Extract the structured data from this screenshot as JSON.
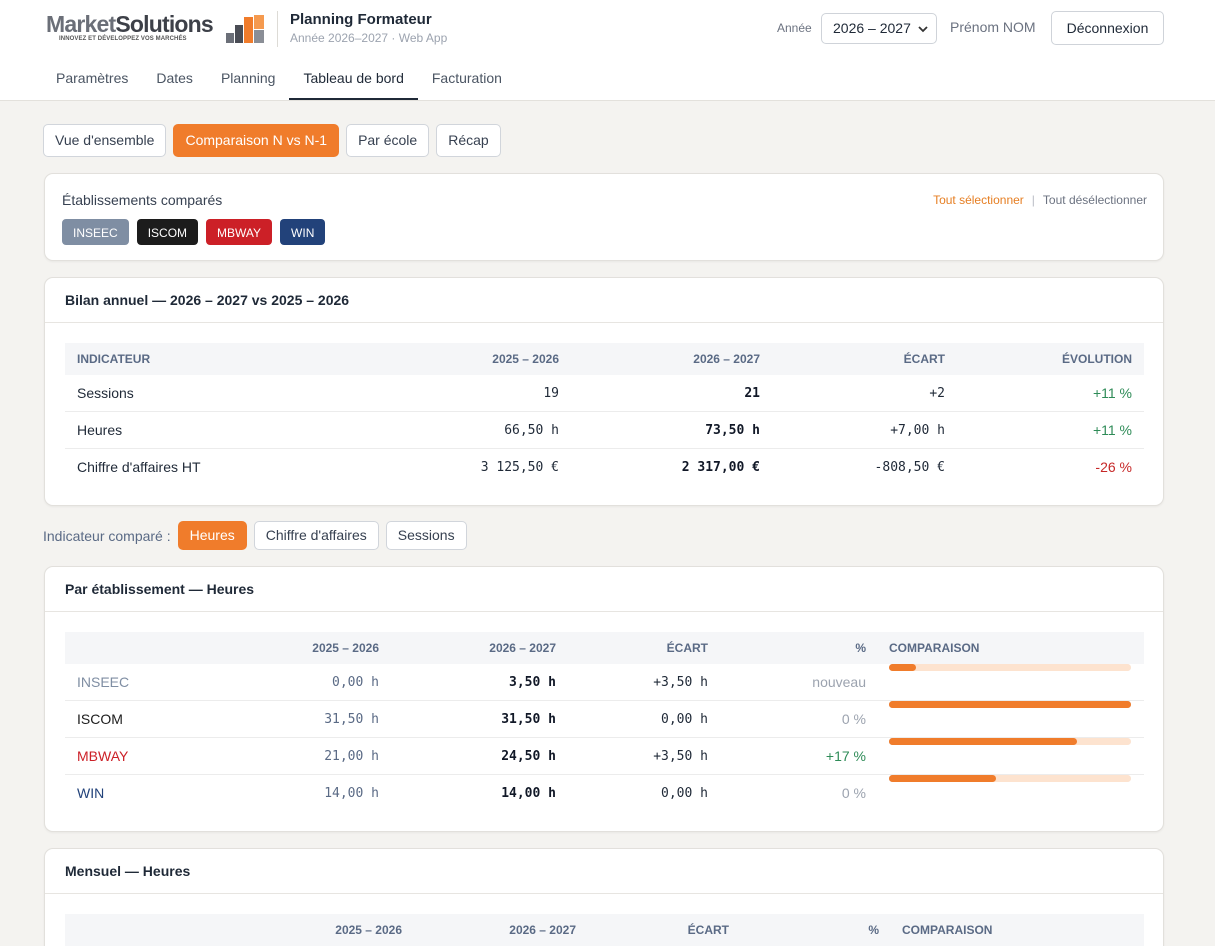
{
  "header": {
    "logo": {
      "word_regular": "Market",
      "word_bold": "Solutions",
      "tagline": "INNOVEZ ET DÉVELOPPEZ VOS MARCHÉS"
    },
    "app_title": "Planning Formateur",
    "app_subtitle": "Année 2026–2027 · Web App",
    "year_label": "Année",
    "year_value": "2026 – 2027",
    "user_name": "Prénom NOM",
    "logout_label": "Déconnexion"
  },
  "nav": [
    {
      "label": "Paramètres",
      "active": false
    },
    {
      "label": "Dates",
      "active": false
    },
    {
      "label": "Planning",
      "active": false
    },
    {
      "label": "Tableau de bord",
      "active": true
    },
    {
      "label": "Facturation",
      "active": false
    }
  ],
  "subtabs": [
    {
      "label": "Vue d'ensemble",
      "active": false
    },
    {
      "label": "Comparaison N vs N-1",
      "active": true
    },
    {
      "label": "Par école",
      "active": false
    },
    {
      "label": "Récap",
      "active": false
    }
  ],
  "establishments": {
    "title": "Établissements comparés",
    "select_all": "Tout sélectionner",
    "separator": "|",
    "deselect_all": "Tout désélectionner",
    "chips": [
      {
        "label": "INSEEC",
        "color": "#7f8ea3"
      },
      {
        "label": "ISCOM",
        "color": "#1c1c1c"
      },
      {
        "label": "MBWAY",
        "color": "#cc2027"
      },
      {
        "label": "WIN",
        "color": "#22427a"
      }
    ]
  },
  "bilan": {
    "title": "Bilan annuel — 2026 – 2027 vs 2025 – 2026",
    "headers": {
      "indicator": "INDICATEUR",
      "prev": "2025 – 2026",
      "curr": "2026 – 2027",
      "diff": "ÉCART",
      "evol": "ÉVOLUTION"
    },
    "rows": [
      {
        "indicator": "Sessions",
        "prev": "19",
        "curr": "21",
        "diff": "+2",
        "evol": "+11 %",
        "trend": "up"
      },
      {
        "indicator": "Heures",
        "prev": "66,50 h",
        "curr": "73,50 h",
        "diff": "+7,00 h",
        "evol": "+11 %",
        "trend": "up"
      },
      {
        "indicator": "Chiffre d'affaires HT",
        "prev": "3 125,50 €",
        "curr": "2 317,00 €",
        "diff": "-808,50 €",
        "evol": "-26 %",
        "trend": "down"
      }
    ]
  },
  "indicator_toggle": {
    "label": "Indicateur comparé :",
    "options": [
      {
        "label": "Heures",
        "active": true
      },
      {
        "label": "Chiffre d'affaires",
        "active": false
      },
      {
        "label": "Sessions",
        "active": false
      }
    ]
  },
  "par_etablissement": {
    "title": "Par établissement — Heures",
    "headers": {
      "name": "",
      "prev": "2025 – 2026",
      "curr": "2026 – 2027",
      "diff": "ÉCART",
      "pct": "%",
      "comparison": "COMPARAISON"
    },
    "rows": [
      {
        "name": "INSEEC",
        "name_color": "#7f8ea3",
        "prev": "0,00 h",
        "curr": "3,50 h",
        "diff": "+3,50 h",
        "pct": "nouveau",
        "pct_tone": "grey",
        "prev_fraction": 0,
        "curr_fraction": 0.11
      },
      {
        "name": "ISCOM",
        "name_color": "#1c1c1c",
        "prev": "31,50 h",
        "curr": "31,50 h",
        "diff": "0,00 h",
        "pct": "0 %",
        "pct_tone": "grey",
        "prev_fraction": 1.0,
        "curr_fraction": 1.0
      },
      {
        "name": "MBWAY",
        "name_color": "#cc2027",
        "prev": "21,00 h",
        "curr": "24,50 h",
        "diff": "+3,50 h",
        "pct": "+17 %",
        "pct_tone": "green",
        "prev_fraction": 0.667,
        "curr_fraction": 0.778
      },
      {
        "name": "WIN",
        "name_color": "#22427a",
        "prev": "14,00 h",
        "curr": "14,00 h",
        "diff": "0,00 h",
        "pct": "0 %",
        "pct_tone": "grey",
        "prev_fraction": 0.444,
        "curr_fraction": 0.444
      }
    ]
  },
  "mensuel": {
    "title": "Mensuel — Heures",
    "headers": {
      "prev": "2025 – 2026",
      "curr": "2026 – 2027",
      "diff": "ÉCART",
      "pct": "%",
      "comparison": "COMPARAISON"
    }
  }
}
